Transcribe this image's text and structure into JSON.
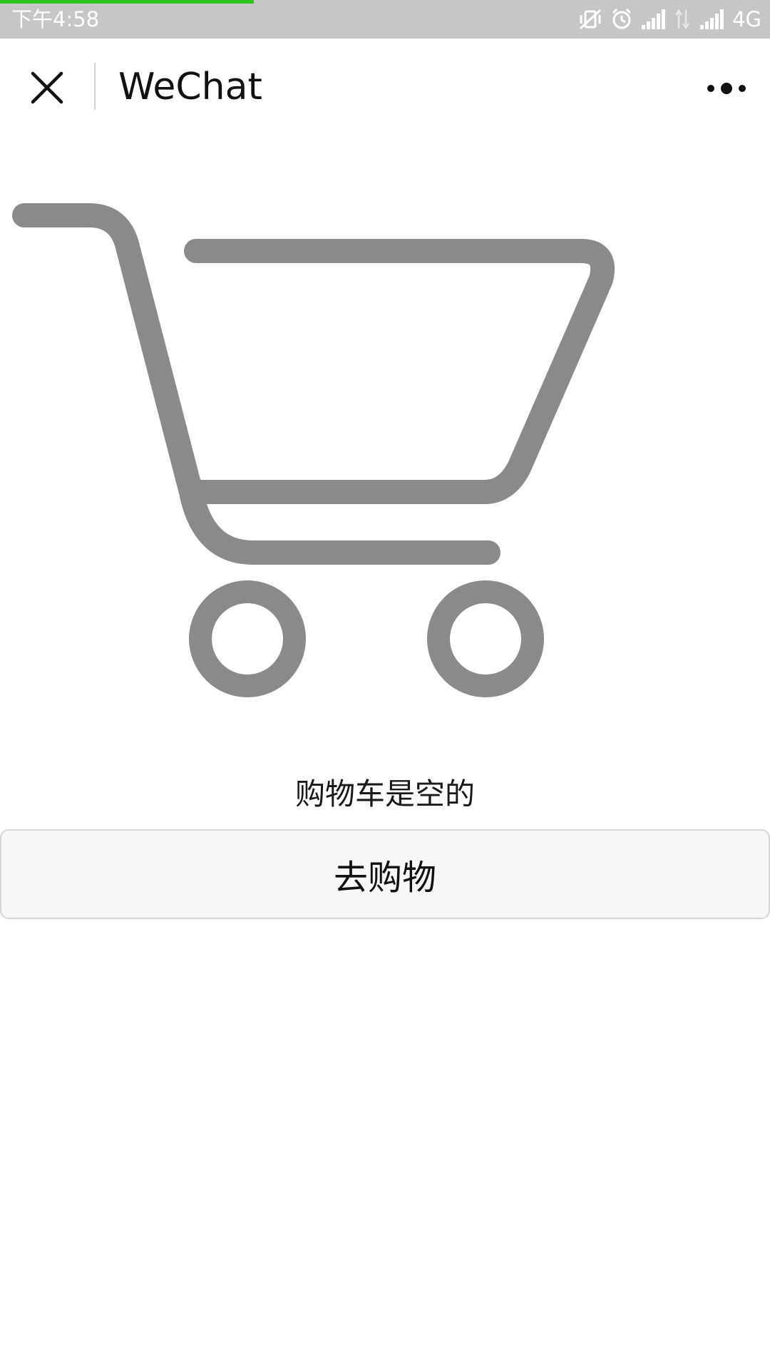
{
  "status_bar": {
    "time": "下午4:58",
    "network": "4G",
    "page_load_progress": 0.33,
    "icons": [
      "vibrate-off-icon",
      "alarm-icon",
      "signal-icon",
      "data-arrows-icon",
      "signal-icon"
    ]
  },
  "nav": {
    "title": "WeChat",
    "close_icon": "close-icon",
    "more_icon": "more-dots-icon"
  },
  "cart": {
    "illustration_icon": "shopping-cart-icon",
    "empty_message": "购物车是空的",
    "button_label": "去购物"
  },
  "colors": {
    "status_bar_bg": "#c6c6c6",
    "progress": "#2fc21a",
    "cart_gray": "#8a8a8a",
    "button_bg": "#f7f7f7"
  }
}
